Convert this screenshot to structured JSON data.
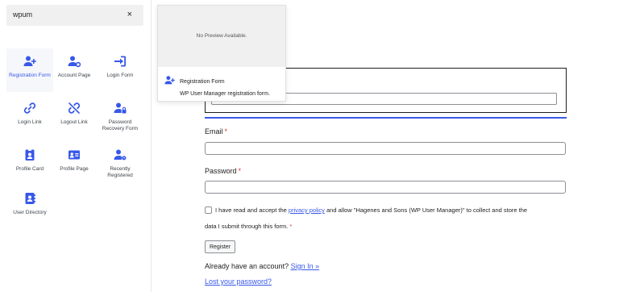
{
  "search": {
    "value": "wpum",
    "clear_label": "×"
  },
  "blocks": [
    {
      "label": "Registration Form",
      "icon": "user-plus-icon"
    },
    {
      "label": "Account Page",
      "icon": "user-gear-icon"
    },
    {
      "label": "Login Form",
      "icon": "sign-in-icon"
    },
    {
      "label": "Login Link",
      "icon": "link-icon"
    },
    {
      "label": "Logout Link",
      "icon": "unlink-icon"
    },
    {
      "label": "Password Recovery Form",
      "icon": "user-lock-icon"
    },
    {
      "label": "Profile Card",
      "icon": "id-badge-icon"
    },
    {
      "label": "Profile Page",
      "icon": "id-card-icon"
    },
    {
      "label": "Recently Registered",
      "icon": "user-clock-icon"
    },
    {
      "label": "User Directory",
      "icon": "address-book-icon"
    }
  ],
  "preview": {
    "empty_text": "No Preview Available.",
    "title": "Registration Form",
    "description": "WP User Manager registration form."
  },
  "form": {
    "email_label": "Email",
    "password_label": "Password",
    "required_mark": "*",
    "consent_before": "I have read and accept the ",
    "consent_link": "privacy policy",
    "consent_after": " and allow \"Hagenes and Sons (WP User Manager)\" to collect and store the",
    "consent_line2": "data I submit through this form.",
    "register_label": "Register",
    "signin_prompt": "Already have an account? ",
    "signin_link": "Sign In »",
    "lost_password_link": "Lost your password?"
  },
  "colors": {
    "accent": "#3858e9",
    "required": "#d63638",
    "text": "#1e1e1e"
  }
}
